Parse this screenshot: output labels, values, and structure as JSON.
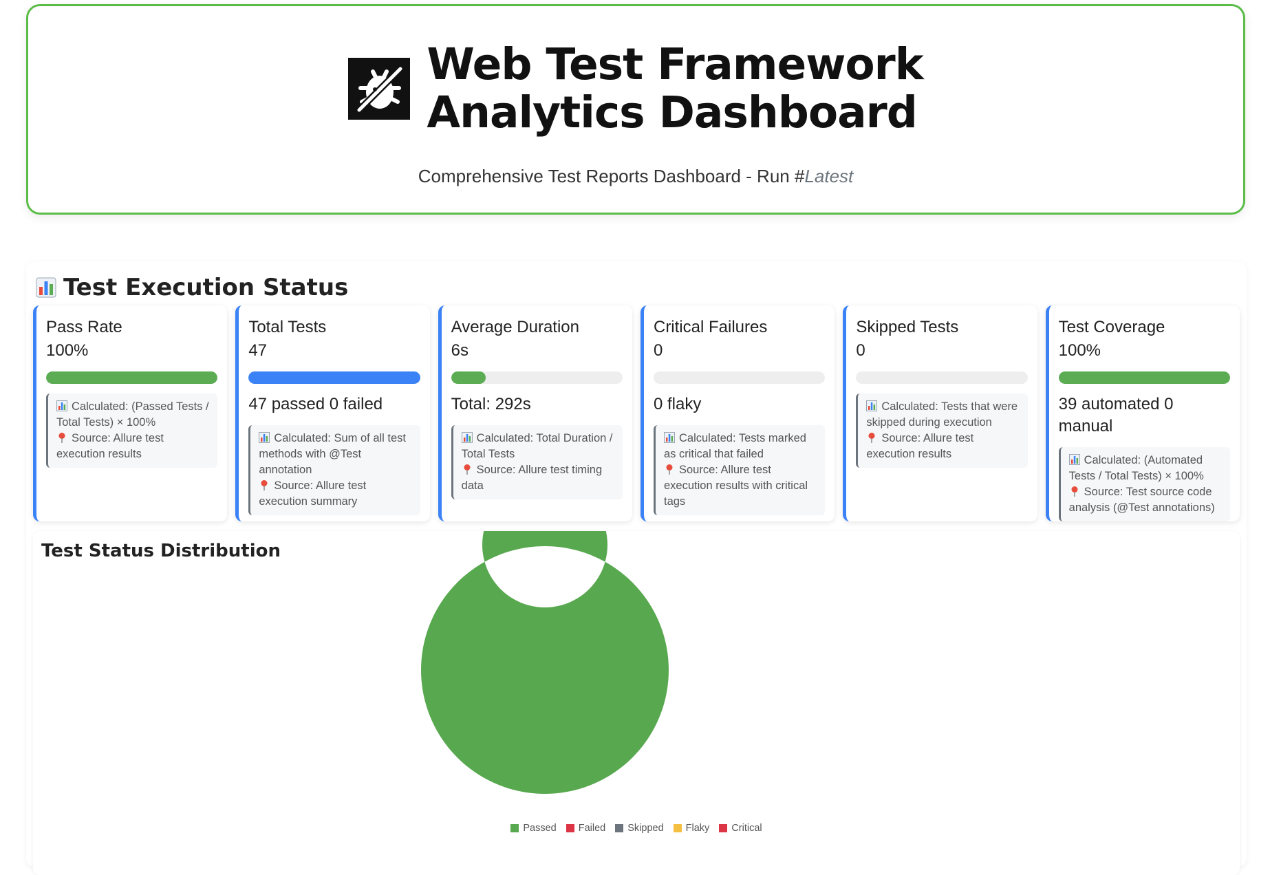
{
  "header": {
    "title_line1": "Web Test Framework",
    "title_line2": "Analytics Dashboard",
    "subtitle_prefix": "Comprehensive Test Reports Dashboard - Run #",
    "subtitle_run": "Latest",
    "logo_icon": "bug-off-icon"
  },
  "section": {
    "title": "Test Execution Status",
    "title_icon": "bar-chart-icon"
  },
  "cards": [
    {
      "title": "Pass Rate",
      "value": "100%",
      "progress_percent": 100,
      "bar_color": "#5bac53",
      "extra": "",
      "calc": "Calculated: (Passed Tests / Total Tests) × 100%",
      "source": "Source: Allure test execution results"
    },
    {
      "title": "Total Tests",
      "value": "47",
      "progress_percent": 100,
      "bar_color": "#3b82f6",
      "extra": "47 passed 0 failed",
      "calc": "Calculated: Sum of all test methods with @Test annotation",
      "source": "Source: Allure test execution summary"
    },
    {
      "title": "Average Duration",
      "value": "6s",
      "progress_percent": 20,
      "bar_color": "#5bac53",
      "extra": "Total: 292s",
      "calc": "Calculated: Total Duration / Total Tests",
      "source": "Source: Allure test timing data"
    },
    {
      "title": "Critical Failures",
      "value": "0",
      "progress_percent": 0,
      "bar_color": "#dc3545",
      "extra": "0 flaky",
      "calc": "Calculated: Tests marked as critical that failed",
      "source": "Source: Allure test execution results with critical tags"
    },
    {
      "title": "Skipped Tests",
      "value": "0",
      "progress_percent": 0,
      "bar_color": "#6c757d",
      "extra": "",
      "calc": "Calculated: Tests that were skipped during execution",
      "source": "Source: Allure test execution results"
    },
    {
      "title": "Test Coverage",
      "value": "100%",
      "progress_percent": 100,
      "bar_color": "#5bac53",
      "extra": "39 automated 0 manual",
      "calc": "Calculated: (Automated Tests / Total Tests) × 100%",
      "source": "Source: Test source code analysis (@Test annotations)"
    }
  ],
  "chart_data": {
    "type": "pie",
    "title": "Test Status Distribution",
    "categories": [
      "Passed",
      "Failed",
      "Skipped",
      "Flaky",
      "Critical"
    ],
    "values": [
      47,
      0,
      0,
      0,
      0
    ],
    "colors": [
      "#58a84f",
      "#dc3545",
      "#6c757d",
      "#f5c042",
      "#dc3545"
    ],
    "donut": true,
    "legend_position": "bottom"
  }
}
